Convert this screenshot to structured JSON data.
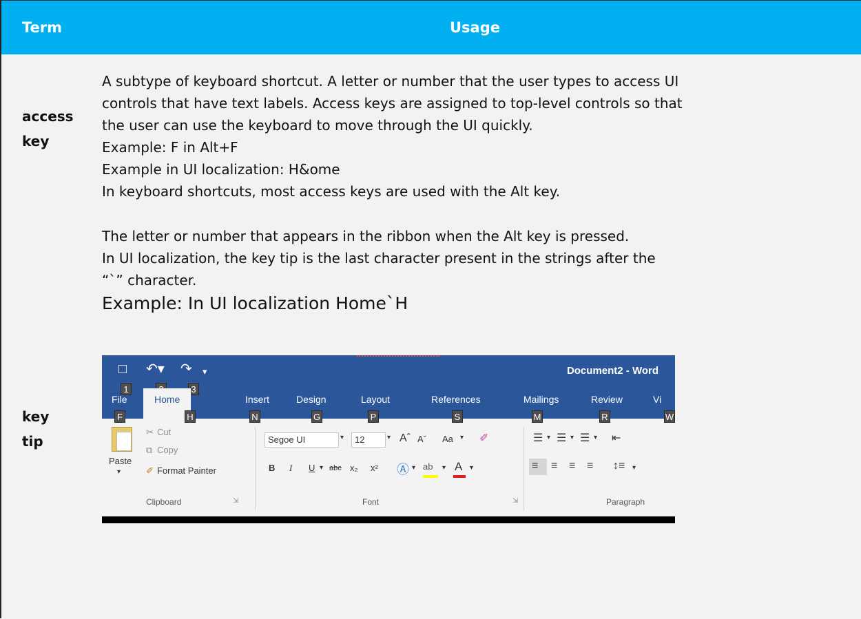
{
  "table": {
    "header": {
      "term": "Term",
      "usage": "Usage"
    },
    "rows": [
      {
        "term_lines": [
          "access",
          "key"
        ],
        "usage_lines": [
          "A subtype of keyboard shortcut. A letter or number that the user types to access UI",
          "controls that have text labels. Access keys are assigned to top-level controls so that",
          "the user can use the keyboard to move through the UI quickly.",
          "Example: F in Alt+F",
          "Example in UI localization: H&ome",
          "In keyboard shortcuts, most access keys are used with the Alt key."
        ]
      },
      {
        "term_lines": [
          "key",
          "tip"
        ],
        "usage_lines": [
          "The letter or number that appears in the ribbon when the Alt key is pressed.",
          "In UI localization, the key tip is the last character present in the strings after the",
          "“`” character."
        ],
        "example": "Example: In UI localization Home`H"
      }
    ]
  },
  "ribbon": {
    "document_title": "Document2 - Word",
    "qat_keytips": [
      "1",
      "2",
      "3"
    ],
    "tabs": [
      {
        "label": "File",
        "keytip": "F"
      },
      {
        "label": "Home",
        "keytip": "H"
      },
      {
        "label": "Insert",
        "keytip": "N"
      },
      {
        "label": "Design",
        "keytip": "G"
      },
      {
        "label": "Layout",
        "keytip": "P"
      },
      {
        "label": "References",
        "keytip": "S"
      },
      {
        "label": "Mailings",
        "keytip": "M"
      },
      {
        "label": "Review",
        "keytip": "R"
      },
      {
        "label": "Vi",
        "keytip": "W"
      }
    ],
    "clipboard": {
      "paste": "Paste",
      "cut": "Cut",
      "copy": "Copy",
      "format_painter": "Format Painter",
      "group": "Clipboard"
    },
    "font": {
      "font_name": "Segoe UI",
      "font_size": "12",
      "change_case": "Aa",
      "bold": "B",
      "italic": "I",
      "underline": "U",
      "strikethrough": "abc",
      "subscript": "x₂",
      "superscript": "x²",
      "group": "Font"
    },
    "paragraph": {
      "group": "Paragraph"
    },
    "icons": {
      "save": "save-icon",
      "undo": "undo-icon",
      "redo": "redo-icon",
      "customize": "customize-qat-icon",
      "cut": "scissors-icon",
      "copy": "copy-icon",
      "brush": "paintbrush-icon"
    },
    "colors": {
      "titlebar": "#2b579a",
      "keytip": "#4f4f4f",
      "highlight": "#ffff00",
      "font_color": "#e02020"
    }
  },
  "colors": {
    "header_bg": "#00b0f0",
    "row_bg": "#f2f2f2"
  }
}
